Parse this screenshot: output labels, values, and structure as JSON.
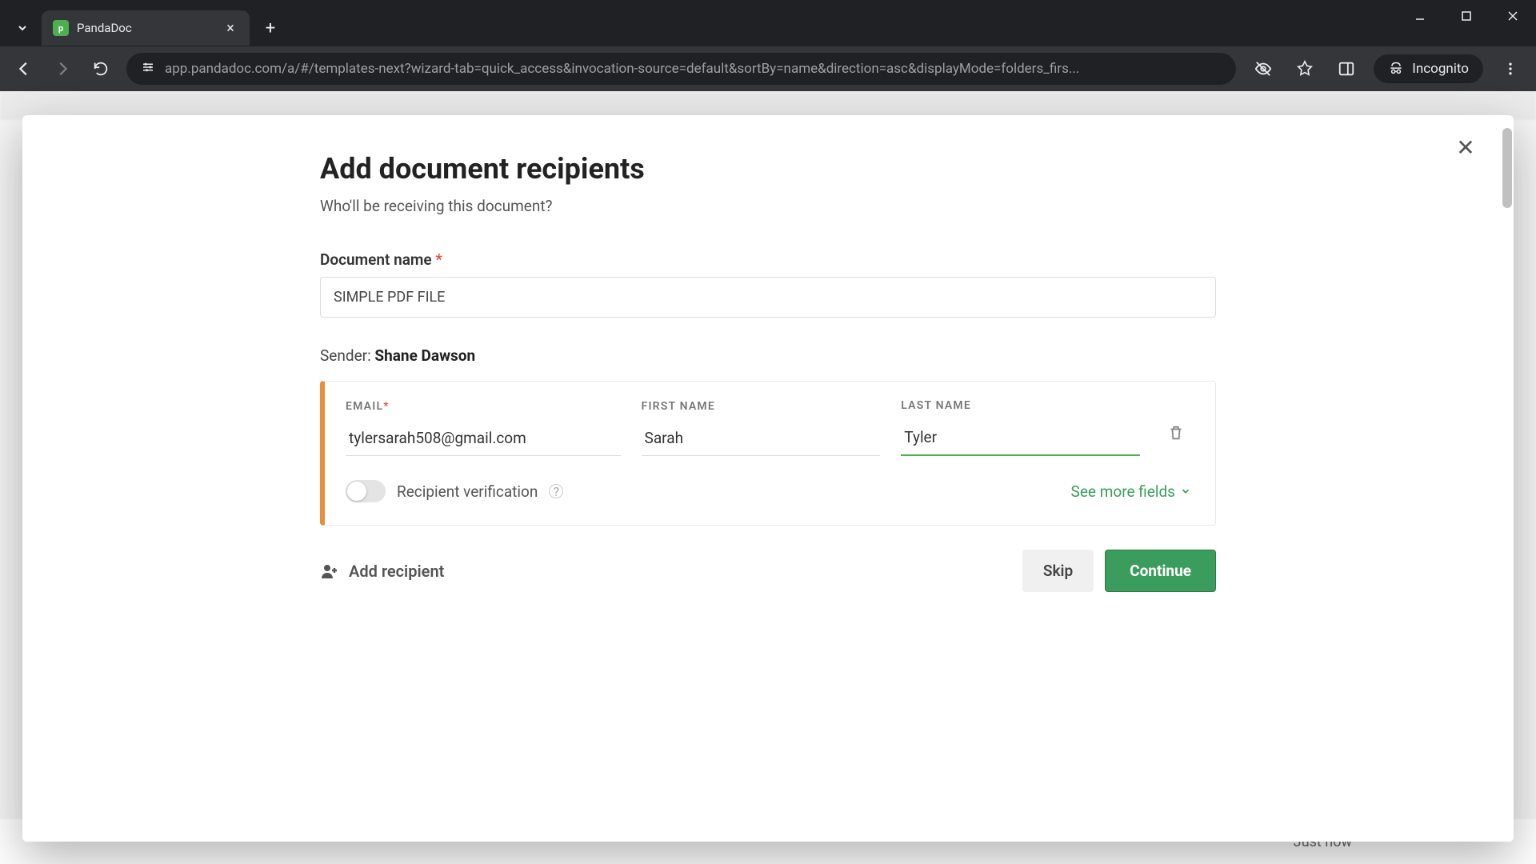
{
  "browser": {
    "tab_title": "PandaDoc",
    "url": "app.pandadoc.com/a/#/templates-next?wizard-tab=quick_access&invocation-source=default&sortBy=name&direction=asc&displayMode=folders_firs...",
    "incognito_label": "Incognito"
  },
  "modal": {
    "title": "Add document recipients",
    "subtitle": "Who'll be receiving this document?",
    "doc_name_label": "Document name",
    "doc_name_value": "SIMPLE PDF FILE",
    "sender_prefix": "Sender:",
    "sender_name": "Shane Dawson",
    "recipient": {
      "email_label": "EMAIL",
      "email_value": "tylersarah508@gmail.com",
      "first_name_label": "FIRST NAME",
      "first_name_value": "Sarah",
      "last_name_label": "LAST NAME",
      "last_name_value": "Tyler"
    },
    "toggle_label": "Recipient verification",
    "see_more_label": "See more fields",
    "add_recipient_label": "Add recipient",
    "skip_label": "Skip",
    "continue_label": "Continue"
  },
  "background": {
    "footer_time": "Just now"
  }
}
